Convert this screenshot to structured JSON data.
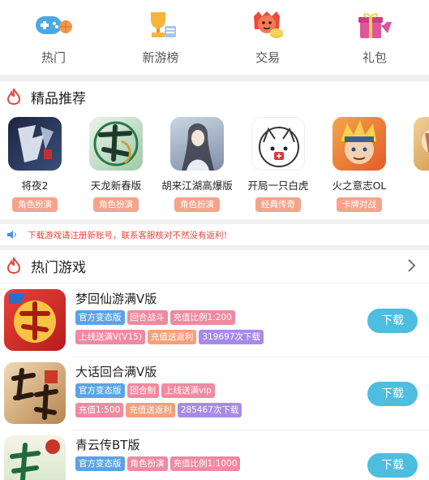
{
  "nav": [
    {
      "label": "热门",
      "icon": "gamepad-icon"
    },
    {
      "label": "新游榜",
      "icon": "trophy-icon"
    },
    {
      "label": "交易",
      "icon": "trade-icon"
    },
    {
      "label": "礼包",
      "icon": "gift-icon"
    }
  ],
  "featured": {
    "title": "精品推荐",
    "items": [
      {
        "name": "将夜2",
        "tag": "角色扮演"
      },
      {
        "name": "天龙新春版",
        "tag": "角色扮演"
      },
      {
        "name": "胡来江湖高爆版",
        "tag": "角色扮演"
      },
      {
        "name": "开局一只白虎",
        "tag": "经典传奇"
      },
      {
        "name": "火之意志OL",
        "tag": "卡牌对战"
      },
      {
        "name": "诸",
        "tag": "角"
      }
    ]
  },
  "notice": {
    "text": "下载游戏请注册新账号，联系客服核对不然没有返利！"
  },
  "hot": {
    "title": "热门游戏",
    "download_label": "下载",
    "games": [
      {
        "name": "梦回仙游满V版",
        "row1": [
          "官方变态版",
          "回合战斗",
          "充值比例1:200"
        ],
        "row2": [
          "上线送满V(V15)",
          "充值送返利",
          "319697次下载"
        ]
      },
      {
        "name": "大话回合满V版",
        "row1": [
          "官方变态版",
          "回合制",
          "上线送满vip"
        ],
        "row2": [
          "充值1:500",
          "充值送返利",
          "285467次下载"
        ]
      },
      {
        "name": "青云传BT版",
        "row1": [
          "官方变态版",
          "角色扮演",
          "充值比例1:1000"
        ],
        "row2": []
      }
    ]
  },
  "colors": {
    "accent": "#4dbde0",
    "notice": "#e5463a",
    "tag": "#f4a48a"
  }
}
